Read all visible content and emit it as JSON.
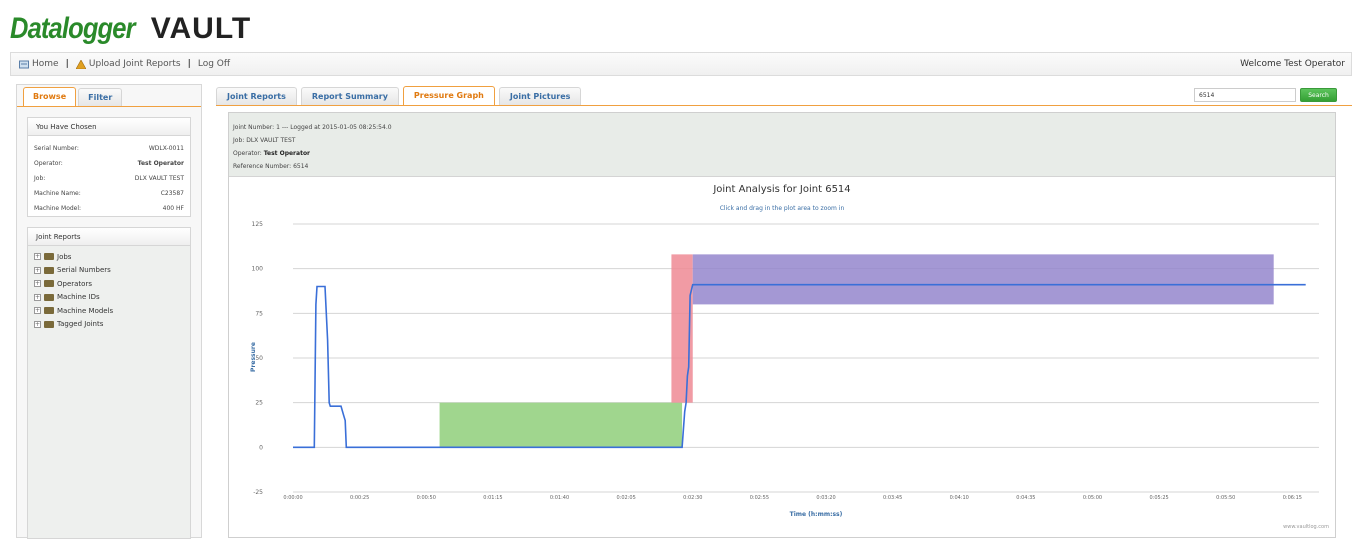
{
  "logo": {
    "part1": "Datalogger",
    "part2": "VAULT"
  },
  "nav": {
    "home": "Home",
    "upload": "Upload Joint Reports",
    "logoff": "Log Off",
    "separator": "|",
    "welcome": "Welcome Test Operator"
  },
  "left": {
    "tabs": [
      "Browse",
      "Filter"
    ],
    "chosen": {
      "title": "You Have Chosen",
      "rows": [
        {
          "label": "Serial Number:",
          "value": "WDLX-0011"
        },
        {
          "label": "Operator:",
          "value": "Test Operator"
        },
        {
          "label": "Job:",
          "value": "DLX VAULT TEST"
        },
        {
          "label": "Machine Name:",
          "value": "C23587"
        },
        {
          "label": "Machine Model:",
          "value": "400 HF"
        }
      ]
    },
    "reports": {
      "title": "Joint Reports",
      "items": [
        "Jobs",
        "Serial Numbers",
        "Operators",
        "Machine IDs",
        "Machine Models",
        "Tagged Joints"
      ]
    }
  },
  "main": {
    "tabs": [
      "Joint Reports",
      "Report Summary",
      "Pressure Graph",
      "Joint Pictures"
    ],
    "active_tab": 2,
    "search": {
      "value": "6514",
      "button": "Search"
    }
  },
  "info": {
    "line1": "Joint Number: 1 --- Logged at 2015-01-05 08:25:54.0",
    "job_label": "Job:",
    "job_value": "DLX VAULT TEST",
    "operator_label": "Operator:",
    "operator_value": "Test Operator",
    "ref_label": "Reference Number:",
    "ref_value": "6514"
  },
  "chart_data": {
    "type": "line",
    "title": "Joint Analysis for Joint 6514",
    "subtitle": "Click and drag in the plot area to zoom in",
    "xlabel": "Time (h:mm:ss)",
    "ylabel": "Pressure",
    "credit": "www.vaultlog.com",
    "xlim_seconds": [
      0,
      385
    ],
    "ylim": [
      -25,
      125
    ],
    "yticks": [
      -25,
      0,
      25,
      50,
      75,
      100,
      125
    ],
    "xticks": [
      "0:00:00",
      "0:00:25",
      "0:00:50",
      "0:01:15",
      "0:01:40",
      "0:02:05",
      "0:02:30",
      "0:02:55",
      "0:03:20",
      "0:03:45",
      "0:04:10",
      "0:04:35",
      "0:05:00",
      "0:05:25",
      "0:05:50",
      "0:06:15"
    ],
    "grid": true,
    "line_color": "#3a6fd8",
    "series": [
      {
        "x_seconds": [
          0,
          8,
          8.6,
          9,
          12,
          13,
          13.6,
          14,
          15,
          18,
          19,
          19.6,
          20,
          140,
          146,
          147,
          147.5,
          148,
          148.5,
          149,
          150,
          380
        ],
        "y": [
          0,
          0,
          80,
          90,
          90,
          60,
          25,
          23,
          23,
          23,
          18,
          15,
          0,
          0,
          0,
          20,
          25,
          40,
          45,
          85,
          91,
          91
        ]
      }
    ],
    "bands": [
      {
        "x_seconds": [
          55,
          146
        ],
        "y": [
          0,
          25
        ],
        "color": "#8fcf7a"
      },
      {
        "x_seconds": [
          142,
          150
        ],
        "y": [
          25,
          108
        ],
        "color": "#ef8a94"
      },
      {
        "x_seconds": [
          150,
          368
        ],
        "y": [
          80,
          108
        ],
        "color": "#9486cc"
      }
    ]
  }
}
